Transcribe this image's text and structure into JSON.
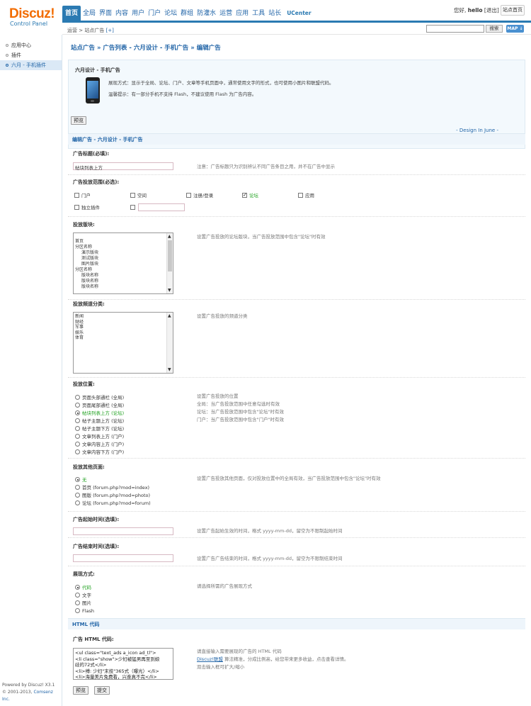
{
  "app": {
    "brand": "Discuz!",
    "subtitle": "Control Panel"
  },
  "nav": [
    "首页",
    "全局",
    "界面",
    "内容",
    "用户",
    "门户",
    "论坛",
    "群组",
    "防灌水",
    "运营",
    "应用",
    "工具",
    "站长",
    "UCenter"
  ],
  "user": {
    "greeting": "您好,",
    "name": "hello",
    "logout": "[退出]",
    "home": "站点首页"
  },
  "breadcrumb": {
    "text": "运营 > 站点广告",
    "plus": "[+]"
  },
  "search": {
    "button": "搜索",
    "map": "MAP ↓"
  },
  "sidebar": {
    "items": [
      "应用中心",
      "插件",
      "六月 - 手机插件"
    ],
    "footer1": "Powered by Discuz! X3.1",
    "footer2_prefix": "© 2001-2013, ",
    "footer2_link": "Comsenz Inc."
  },
  "page": {
    "title": "站点广告 » 广告列表 - 六月设计 - 手机广告 » 编辑广告"
  },
  "info": {
    "title": "六月设计 - 手机广告",
    "desc1": "展现方式：显示于全局、论坛、门户、文章等手机页面中，通常使用文字的形式，也可使用小图片和联盟代码。",
    "desc2": "温馨提示：有一部分手机不支持 Flash，不建议使用 Flash 为广告内容。",
    "design": "- Design In June -"
  },
  "buttons": {
    "preview": "预览",
    "submit": "提交"
  },
  "form": {
    "section": "编辑广告 - 六月设计 - 手机广告",
    "title_label": "广告标题(必填):",
    "title_value": "帖块列表上方",
    "title_tip": "注意：广告标题只为识别辨认不同广告条目之用，并不在广告中显示",
    "scope_label": "广告投放范围(必选):",
    "scope": [
      {
        "label": "门户",
        "checked": false
      },
      {
        "label": "空间",
        "checked": false
      },
      {
        "label": "注册/登录",
        "checked": false
      },
      {
        "label": "论坛",
        "checked": true
      },
      {
        "label": "应用",
        "checked": false
      },
      {
        "label": "独立插件",
        "checked": false
      },
      {
        "label": "",
        "checked": false
      }
    ],
    "board_label": "投放版块:",
    "board_options": [
      "首页",
      "分区名称",
      "演示版块",
      "测试版块",
      "图片版块",
      "分区名称",
      "版块名称",
      "版块名称",
      "版块名称"
    ],
    "board_tip": "设置广告投放的论坛版块，当广告投放范围中包含\"论坛\"时有效",
    "channel_label": "投放频道分类:",
    "channel_options": [
      "新闻",
      "财经",
      "军事",
      "娱乐",
      "体育"
    ],
    "channel_tip": "设置广告投放的频道分类",
    "position_label": "投放位置:",
    "positions": [
      {
        "label": "页面头部通栏 (全局)",
        "checked": false
      },
      {
        "label": "页面尾部通栏 (全局)",
        "checked": false
      },
      {
        "label": "帖块列表上方 (论坛)",
        "checked": true
      },
      {
        "label": "帖子主题上方 (论坛)",
        "checked": false
      },
      {
        "label": "帖子主题下方 (论坛)",
        "checked": false
      },
      {
        "label": "文章列表上方 (门户)",
        "checked": false
      },
      {
        "label": "文章内容上方 (门户)",
        "checked": false
      },
      {
        "label": "文章内容下方 (门户)",
        "checked": false
      }
    ],
    "position_tips": [
      "设置广告投放的位置",
      "全局：当广告投放范围中任意勾选时有效",
      "论坛：当广告投放范围中包含\"论坛\"时有效",
      "门户：当广告投放范围中包含\"门户\"时有效"
    ],
    "other_label": "投放其他页面:",
    "others": [
      {
        "label": "无",
        "checked": true
      },
      {
        "label": "首页 (forum.php?mod=index)",
        "checked": false
      },
      {
        "label": "图版 (forum.php?mod=photo)",
        "checked": false
      },
      {
        "label": "论坛 (forum.php?mod=forum)",
        "checked": false
      }
    ],
    "other_tip": "设置广告投放其他页面，仅对投放位置中的全局有效，当广告投放范围中包含\"论坛\"时有效",
    "start_label": "广告起始时间(选填):",
    "start_tip": "设置广告起始生效的时间，格式 yyyy-mm-dd，留空为不限制起始时间",
    "end_label": "广告结束时间(选填):",
    "end_tip": "设置广告广告结束的时间，格式 yyyy-mm-dd，留空为不限制结束时间",
    "style_label": "展现方式:",
    "styles": [
      {
        "label": "代码",
        "checked": true
      },
      {
        "label": "文字",
        "checked": false
      },
      {
        "label": "图片",
        "checked": false
      },
      {
        "label": "Flash",
        "checked": false
      }
    ],
    "style_tip": "请选择所需的广告展现方式",
    "html_section": "HTML 代码",
    "html_label": "广告 HTML 代码:",
    "html_code": [
      "<ul class=\"text_ads a_icon ad_tl\">",
      "<li class=\"show\">少妇被猛男再至到娘",
      "歧的72式</li>",
      "<li>缚: 少妇\"末技\"365式（曝光）</li>",
      "<li>海量美片免费看，兴奋真不完</li>"
    ],
    "html_tip1": "请直接输入需要展现的广告的 HTML 代码",
    "html_tip2_link": "Discuz!联盟",
    "html_tip2_rest": " 算法精准，分成比例高，给您带来更多收益，点击查看详情。",
    "html_tip3": "双击输入框可扩大/缩小"
  }
}
